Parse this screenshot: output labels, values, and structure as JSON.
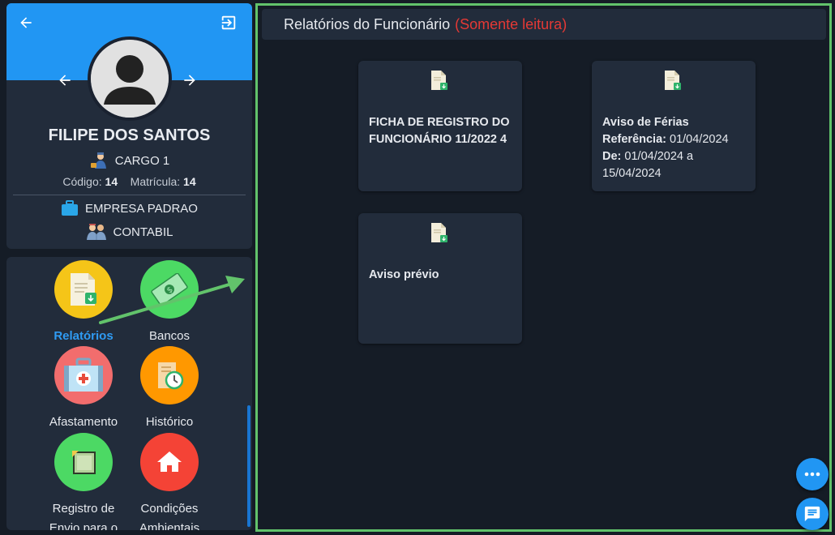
{
  "profile": {
    "name": "FILIPE DOS SANTOS",
    "cargo": "CARGO 1",
    "codigo_label": "Código:",
    "codigo_value": "14",
    "matricula_label": "Matrícula:",
    "matricula_value": "14",
    "empresa": "EMPRESA PADRAO",
    "contabil": "CONTABIL",
    "banner_color": "#2196f3"
  },
  "menu": {
    "items": [
      {
        "label": "Relatórios",
        "icon": "report-document-icon",
        "color": "#f5c518",
        "active": true
      },
      {
        "label": "Bancos",
        "icon": "money-icon",
        "color": "#4cd964"
      },
      {
        "label": "Afastamento",
        "icon": "first-aid-kit-icon",
        "color": "#f26d6d"
      },
      {
        "label": "Histórico",
        "icon": "history-clock-icon",
        "color": "#ff9800"
      },
      {
        "label": "Registro de Envio para o",
        "icon": "register-sticker-icon",
        "color": "#4cd964"
      },
      {
        "label": "Condições Ambientais",
        "icon": "home-icon",
        "color": "#f44336"
      }
    ]
  },
  "main": {
    "title": "Relatórios do Funcionário",
    "readonly": "(Somente leitura)",
    "reports": [
      {
        "line1": "FICHA DE REGISTRO DO FUNCIONÁRIO 11/2022 4"
      },
      {
        "title": "Aviso de Férias",
        "ref_label": "Referência:",
        "ref_value": "01/04/2024",
        "de_label": "De:",
        "de_value": "01/04/2024 a 15/04/2024"
      },
      {
        "line1": "Aviso prévio"
      }
    ]
  },
  "colors": {
    "accent": "#2196f3",
    "highlight_border": "#62c36b",
    "readonly": "#e53935",
    "card_bg": "#222c3b",
    "page_bg": "#151c26"
  }
}
